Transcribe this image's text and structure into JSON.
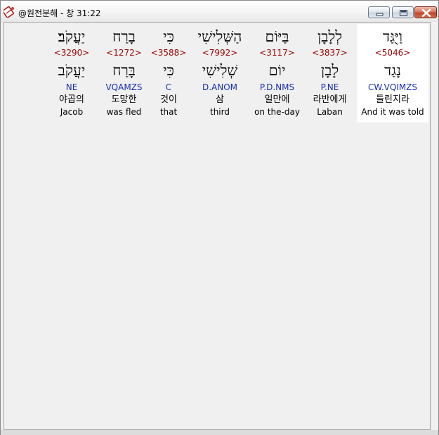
{
  "window": {
    "title": "@원전분해 - 창 31:22",
    "icon": "app-bible-icon",
    "controls": [
      "minimize",
      "maximize",
      "close"
    ]
  },
  "words": [
    {
      "hebrew": "וַיֻּגַּד",
      "strong": "<5046>",
      "lemma": "נָגַד",
      "parsing": "CW.VQIMZS",
      "korean": "들린지라",
      "english": "And it was told",
      "selected": true
    },
    {
      "hebrew": "לְלָבָן",
      "strong": "<3837>",
      "lemma": "לָבָן",
      "parsing": "P.NE",
      "korean": "라반에게",
      "english": "Laban",
      "selected": false
    },
    {
      "hebrew": "בַּיּוֹם",
      "strong": "<3117>",
      "lemma": "יוֹם",
      "parsing": "P.D.NMS",
      "korean": "일만에",
      "english": "on the-day",
      "selected": false
    },
    {
      "hebrew": "הַשְּׁלִישִׁי",
      "strong": "<7992>",
      "lemma": "שְׁלִישִׁי",
      "parsing": "D.ANOM",
      "korean": "삼",
      "english": "third",
      "selected": false
    },
    {
      "hebrew": "כִּי",
      "strong": "<3588>",
      "lemma": "כִּי",
      "parsing": "C",
      "korean": "것이",
      "english": "that",
      "selected": false
    },
    {
      "hebrew": "בָרַח",
      "strong": "<1272>",
      "lemma": "בָּרַח",
      "parsing": "VQAMZS",
      "korean": "도망한",
      "english": "was fled",
      "selected": false
    },
    {
      "hebrew": "יַעֲקֹב׃",
      "strong": "<3290>",
      "lemma": "יַעֲקֹב",
      "parsing": "NE",
      "korean": "야곱의",
      "english": "Jacob",
      "selected": false
    }
  ]
}
